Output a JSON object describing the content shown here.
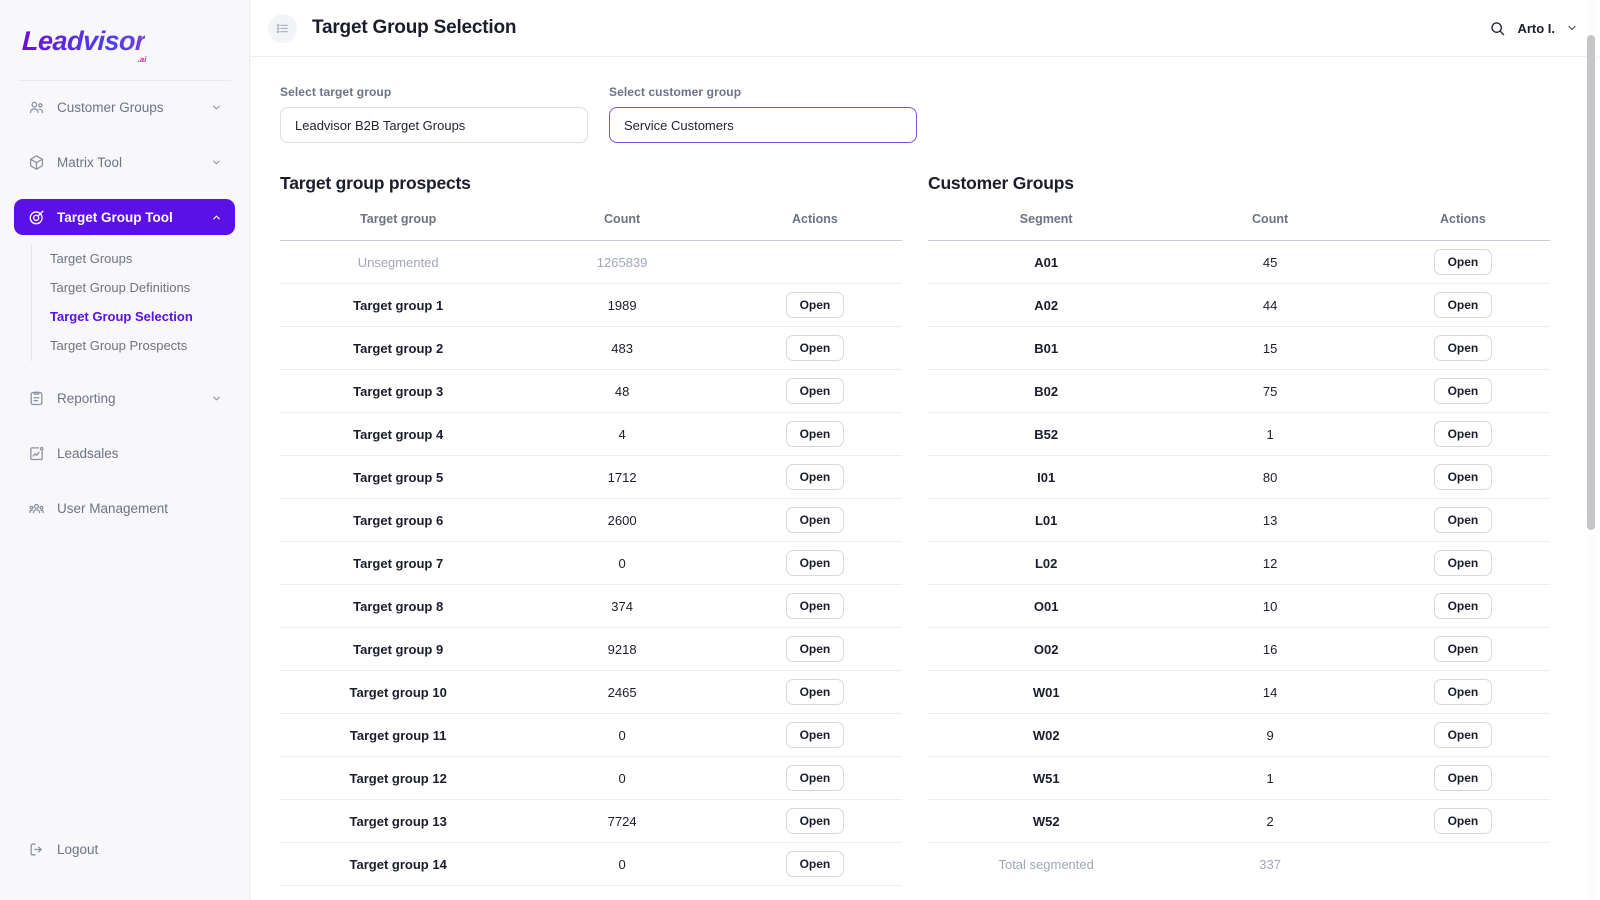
{
  "brand": {
    "name": "Leadvisor",
    "suffix": ".ai",
    "accent_purple": "#5b10e5",
    "accent_pink": "#e0218a"
  },
  "sidebar": {
    "items": [
      {
        "label": "Customer Groups",
        "icon": "users-icon",
        "expandable": true,
        "expanded": false
      },
      {
        "label": "Matrix Tool",
        "icon": "cube-icon",
        "expandable": true,
        "expanded": false
      },
      {
        "label": "Target Group Tool",
        "icon": "target-icon",
        "expandable": true,
        "expanded": true,
        "active": true
      },
      {
        "label": "Reporting",
        "icon": "clipboard-icon",
        "expandable": true,
        "expanded": false
      },
      {
        "label": "Leadsales",
        "icon": "chart-box-icon",
        "expandable": false,
        "expanded": false
      },
      {
        "label": "User Management",
        "icon": "user-group-icon",
        "expandable": false,
        "expanded": false
      }
    ],
    "subnav": [
      {
        "label": "Target Groups",
        "selected": false
      },
      {
        "label": "Target Group Definitions",
        "selected": false
      },
      {
        "label": "Target Group Selection",
        "selected": true
      },
      {
        "label": "Target Group Prospects",
        "selected": false
      }
    ],
    "logout": {
      "label": "Logout",
      "icon": "logout-icon"
    }
  },
  "topbar": {
    "menu_icon": "list-icon",
    "title": "Target Group Selection",
    "search_icon": "search-icon",
    "user_name": "Arto I.",
    "user_chevron_icon": "chevron-down-icon"
  },
  "selectors": [
    {
      "label": "Select target group",
      "value": "Leadvisor B2B Target Groups",
      "focused": false
    },
    {
      "label": "Select customer group",
      "value": "Service Customers",
      "focused": true
    }
  ],
  "target_group_panel": {
    "title": "Target group prospects",
    "columns": [
      "Target group",
      "Count",
      "Actions"
    ],
    "action_label": "Open",
    "rows": [
      {
        "name": "Unsegmented",
        "count": "1265839",
        "muted": true,
        "action": false
      },
      {
        "name": "Target group 1",
        "count": "1989",
        "muted": false,
        "action": true
      },
      {
        "name": "Target group 2",
        "count": "483",
        "muted": false,
        "action": true
      },
      {
        "name": "Target group 3",
        "count": "48",
        "muted": false,
        "action": true
      },
      {
        "name": "Target group 4",
        "count": "4",
        "muted": false,
        "action": true
      },
      {
        "name": "Target group 5",
        "count": "1712",
        "muted": false,
        "action": true
      },
      {
        "name": "Target group 6",
        "count": "2600",
        "muted": false,
        "action": true
      },
      {
        "name": "Target group 7",
        "count": "0",
        "muted": false,
        "action": true
      },
      {
        "name": "Target group 8",
        "count": "374",
        "muted": false,
        "action": true
      },
      {
        "name": "Target group 9",
        "count": "9218",
        "muted": false,
        "action": true
      },
      {
        "name": "Target group 10",
        "count": "2465",
        "muted": false,
        "action": true
      },
      {
        "name": "Target group 11",
        "count": "0",
        "muted": false,
        "action": true
      },
      {
        "name": "Target group 12",
        "count": "0",
        "muted": false,
        "action": true
      },
      {
        "name": "Target group 13",
        "count": "7724",
        "muted": false,
        "action": true
      },
      {
        "name": "Target group 14",
        "count": "0",
        "muted": false,
        "action": true
      }
    ]
  },
  "customer_groups_panel": {
    "title": "Customer Groups",
    "columns": [
      "Segment",
      "Count",
      "Actions"
    ],
    "action_label": "Open",
    "rows": [
      {
        "name": "A01",
        "count": "45",
        "muted": false,
        "action": true
      },
      {
        "name": "A02",
        "count": "44",
        "muted": false,
        "action": true
      },
      {
        "name": "B01",
        "count": "15",
        "muted": false,
        "action": true
      },
      {
        "name": "B02",
        "count": "75",
        "muted": false,
        "action": true
      },
      {
        "name": "B52",
        "count": "1",
        "muted": false,
        "action": true
      },
      {
        "name": "I01",
        "count": "80",
        "muted": false,
        "action": true
      },
      {
        "name": "L01",
        "count": "13",
        "muted": false,
        "action": true
      },
      {
        "name": "L02",
        "count": "12",
        "muted": false,
        "action": true
      },
      {
        "name": "O01",
        "count": "10",
        "muted": false,
        "action": true
      },
      {
        "name": "O02",
        "count": "16",
        "muted": false,
        "action": true
      },
      {
        "name": "W01",
        "count": "14",
        "muted": false,
        "action": true
      },
      {
        "name": "W02",
        "count": "9",
        "muted": false,
        "action": true
      },
      {
        "name": "W51",
        "count": "1",
        "muted": false,
        "action": true
      },
      {
        "name": "W52",
        "count": "2",
        "muted": false,
        "action": true
      },
      {
        "name": "Total segmented",
        "count": "337",
        "muted": true,
        "action": false,
        "total": true
      }
    ]
  }
}
